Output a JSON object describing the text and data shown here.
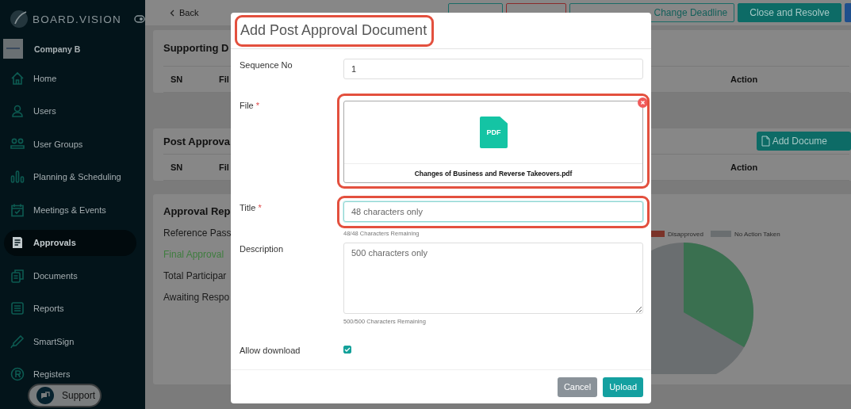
{
  "sidebar": {
    "logo": "BOARD.VISION",
    "company": "Company B",
    "items": [
      {
        "label": "Home",
        "kind": "home",
        "selected": false
      },
      {
        "label": "Users",
        "kind": "user",
        "selected": false
      },
      {
        "label": "User Groups",
        "kind": "group",
        "selected": false
      },
      {
        "label": "Planning & Scheduling",
        "kind": "bars",
        "selected": false
      },
      {
        "label": "Meetings & Events",
        "kind": "calendar",
        "selected": false
      },
      {
        "label": "Approvals",
        "kind": "doc",
        "selected": true
      },
      {
        "label": "Documents",
        "kind": "docs",
        "selected": false
      },
      {
        "label": "Reports",
        "kind": "list",
        "selected": false
      },
      {
        "label": "SmartSign",
        "kind": "pen",
        "selected": false
      },
      {
        "label": "Registers",
        "kind": "registered",
        "selected": false
      }
    ],
    "support": "Support"
  },
  "toolbar": {
    "back": "Back",
    "buttons": [
      {
        "kind": "outline"
      },
      {
        "kind": "danger"
      },
      {
        "label": "Change Deadline",
        "kind": "outline"
      },
      {
        "label": "Close and Resolve",
        "kind": "primary"
      },
      {
        "kind": "info"
      }
    ]
  },
  "sections": [
    {
      "title": "Supporting D",
      "columns": [
        "SN",
        "Fil"
      ],
      "action_column": "Action"
    },
    {
      "title": "Post Approva",
      "button": "Add Docume",
      "columns": [
        "SN",
        "Fil"
      ],
      "action_column": "Action"
    }
  ],
  "report": {
    "title": "Approval Rep",
    "lines": [
      {
        "text": "Reference Pass",
        "kind": "plain"
      },
      {
        "text": "Final Approval",
        "kind": "success"
      },
      {
        "text": "Total Participar",
        "kind": "plain"
      },
      {
        "text": "Awaiting Respo",
        "kind": "plain"
      }
    ],
    "legend": [
      {
        "label": "Disapproved",
        "color": "#7b3329"
      },
      {
        "label": "No Action Taken",
        "color": "#6a6e70"
      }
    ]
  },
  "modal": {
    "title": "Add Post Approval Document",
    "highlighted": true,
    "fields": [
      {
        "kind": "text",
        "label": "Sequence No",
        "value": "1",
        "focused": false
      },
      {
        "kind": "file",
        "label": "File",
        "required_mark": "*",
        "file_type": "PDF",
        "file_name": "Changes of Business and Reverse Takeovers.pdf",
        "highlighted": true
      },
      {
        "kind": "text",
        "label": "Title",
        "required_mark": "*",
        "placeholder": "48 characters only",
        "hint": "48/48 Characters Remaining",
        "highlighted": true,
        "focused": true
      },
      {
        "kind": "textarea",
        "label": "Description",
        "placeholder": "500 characters only",
        "hint": "500/500 Characters Remaining"
      },
      {
        "kind": "checkbox",
        "label": "Allow download",
        "checked": true
      }
    ],
    "buttons": [
      {
        "label": "Cancel",
        "kind": "secondary"
      },
      {
        "label": "Upload",
        "kind": "primary"
      }
    ]
  }
}
